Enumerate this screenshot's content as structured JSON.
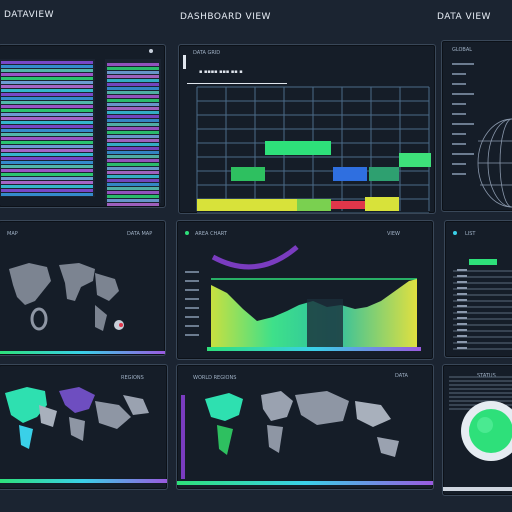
{
  "header": {
    "left_title": "DATAVIEW",
    "center_title": "DASHBOARD VIEW",
    "right_title": "DATA VIEW"
  },
  "panels": {
    "heatbars": {
      "title": ""
    },
    "grid": {
      "title": "DATA GRID",
      "legend": "▪ ▪▪▪▪ ▪▪▪ ▪▪ ▪"
    },
    "globe": {
      "title": "GLOBAL"
    },
    "map_top": {
      "title": "MAP",
      "right_label": "DATA MAP"
    },
    "area": {
      "title": "AREA CHART",
      "right_label": "VIEW"
    },
    "list": {
      "title": "LIST"
    },
    "map_bottom": {
      "title": "",
      "right_label": "REGIONS"
    },
    "map_center": {
      "title": "WORLD REGIONS",
      "right_label": "DATA"
    },
    "gauge": {
      "title": "",
      "right_label": "STATUS"
    }
  },
  "colors": {
    "accent_green": "#2ee07a",
    "accent_cyan": "#3ad0e8",
    "accent_purple": "#7a3cc0",
    "accent_yellow": "#d8e23a",
    "accent_red": "#e0364a",
    "accent_blue": "#2f6fe0"
  }
}
